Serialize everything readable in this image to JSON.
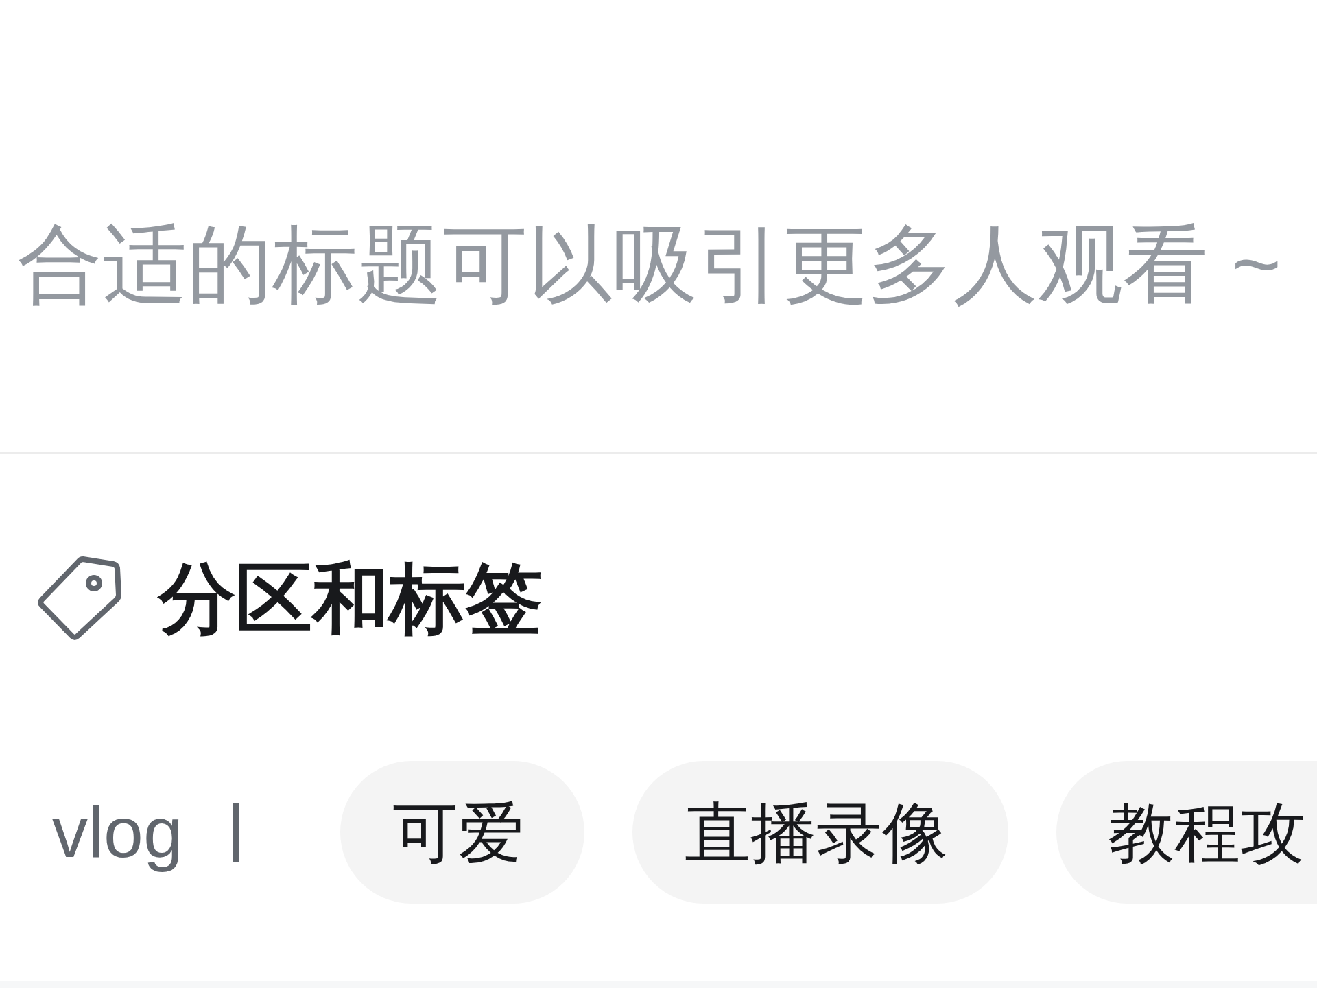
{
  "title_field": {
    "placeholder": "合适的标题可以吸引更多人观看 ~"
  },
  "section": {
    "title": "分区和标签"
  },
  "tag_input": {
    "value": "vlog",
    "focused": true
  },
  "tags": [
    {
      "label": "可爱"
    },
    {
      "label": "直播录像"
    },
    {
      "label": "教程攻"
    }
  ]
}
